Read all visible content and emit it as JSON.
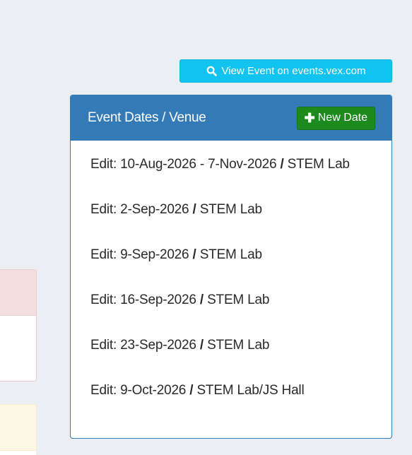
{
  "view_event_button": {
    "label": "View Event on events.vex.com",
    "icon": "search-icon"
  },
  "panel": {
    "title": "Event Dates / Venue",
    "new_date_label": "New Date",
    "new_date_icon": "plus-icon"
  },
  "dates": [
    {
      "prefix": "Edit:",
      "date": "10-Aug-2026 - 7-Nov-2026",
      "sep": "/",
      "venue": "STEM Lab"
    },
    {
      "prefix": "Edit:",
      "date": "2-Sep-2026",
      "sep": "/",
      "venue": "STEM Lab"
    },
    {
      "prefix": "Edit:",
      "date": "9-Sep-2026",
      "sep": "/",
      "venue": "STEM Lab"
    },
    {
      "prefix": "Edit:",
      "date": "16-Sep-2026",
      "sep": "/",
      "venue": "STEM Lab"
    },
    {
      "prefix": "Edit:",
      "date": "23-Sep-2026",
      "sep": "/",
      "venue": "STEM Lab"
    },
    {
      "prefix": "Edit:",
      "date": "9-Oct-2026",
      "sep": "/",
      "venue": "STEM Lab/JS Hall"
    }
  ],
  "colors": {
    "background": "#ebeef3",
    "panel_primary": "#337ab7",
    "info_button": "#11c3ee",
    "success_button": "#1c8a1c",
    "danger_bg": "#f2dede",
    "warning_bg": "#fcf8e3"
  }
}
